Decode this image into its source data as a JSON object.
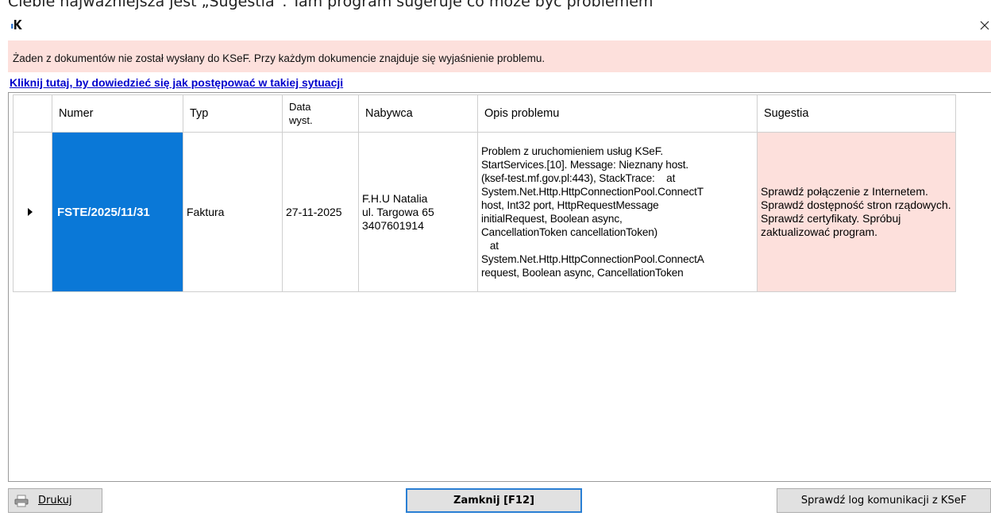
{
  "caption": "Ciebie najważniejsza jest „Sugestia”. Tam program sugeruje co może być problemem",
  "window": {
    "alert": "Żaden z dokumentów nie został wysłany do KSeF. Przy każdym dokumencie znajduje się wyjaśnienie problemu.",
    "help_link": "Kliknij tutaj, by dowiedzieć się jak postępować w takiej sytuacji"
  },
  "table": {
    "headers": {
      "numer": "Numer",
      "typ": "Typ",
      "data": "Data\nwyst.",
      "nabywca": "Nabywca",
      "opis": "Opis problemu",
      "sugestia": "Sugestia"
    },
    "rows": [
      {
        "numer": "FSTE/2025/11/31",
        "typ": "Faktura",
        "data": "27-11-2025",
        "nabywca": "F.H.U Natalia\nul. Targowa 65\n3407601914",
        "opis": "Problem z uruchomieniem usług KSeF.\nStartServices.[10]. Message: Nieznany host.\n(ksef-test.mf.gov.pl:443), StackTrace:    at\nSystem.Net.Http.HttpConnectionPool.ConnectT\nhost, Int32 port, HttpRequestMessage\ninitialRequest, Boolean async,\nCancellationToken cancellationToken)\n   at\nSystem.Net.Http.HttpConnectionPool.ConnectA\nrequest, Boolean async, CancellationToken",
        "sugestia": "Sprawdź połączenie z Internetem. Sprawdź dostępność stron rządowych. Sprawdź certyfikaty. Spróbuj zaktualizować program."
      }
    ]
  },
  "footer": {
    "print": "Drukuj",
    "close": "Zamknij [F12]",
    "log": "Sprawdź log komunikacji z KSeF"
  },
  "colors": {
    "alert_bg": "#fde0dc",
    "selected_cell": "#0a78d7",
    "link": "#0000cc",
    "focus_border": "#2a7fd4"
  }
}
